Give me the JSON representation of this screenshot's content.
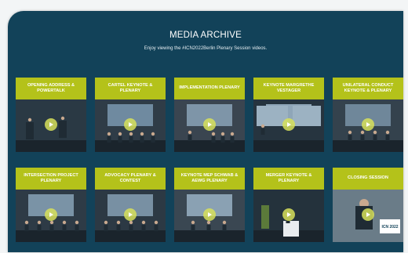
{
  "header": {
    "title": "MEDIA ARCHIVE",
    "subtitle": "Enjoy viewing the #ICN2022Berlin Plenary Session videos."
  },
  "colors": {
    "panel_bg": "#124259",
    "card_header": "#b4c21a",
    "play_button": "#d7e15a"
  },
  "videos": [
    {
      "label": "OPENING ADDRESS & POWERTALK",
      "play_icon": "play-icon"
    },
    {
      "label": "CARTEL KEYNOTE & PLENARY",
      "play_icon": "play-icon"
    },
    {
      "label": "IMPLEMENTATION PLENARY",
      "play_icon": "play-icon"
    },
    {
      "label": "KEYNOTE MARGRETHE VESTAGER",
      "play_icon": "play-icon"
    },
    {
      "label": "UNILATERAL CONDUCT KEYNOTE & PLENARY",
      "play_icon": "play-icon"
    },
    {
      "label": "INTERSECTION PROJECT PLENARY",
      "play_icon": "play-icon"
    },
    {
      "label": "ADVOCACY PLENARY & CONTEST",
      "play_icon": "play-icon"
    },
    {
      "label": "KEYNOTE MEP SCHWAB & AEWG PLENARY",
      "play_icon": "play-icon"
    },
    {
      "label": "MERGER KEYNOTE & PLENARY",
      "play_icon": "play-icon"
    },
    {
      "label": "CLOSING SESSION",
      "play_icon": "play-icon"
    }
  ],
  "logo_text": "ICN 2022"
}
